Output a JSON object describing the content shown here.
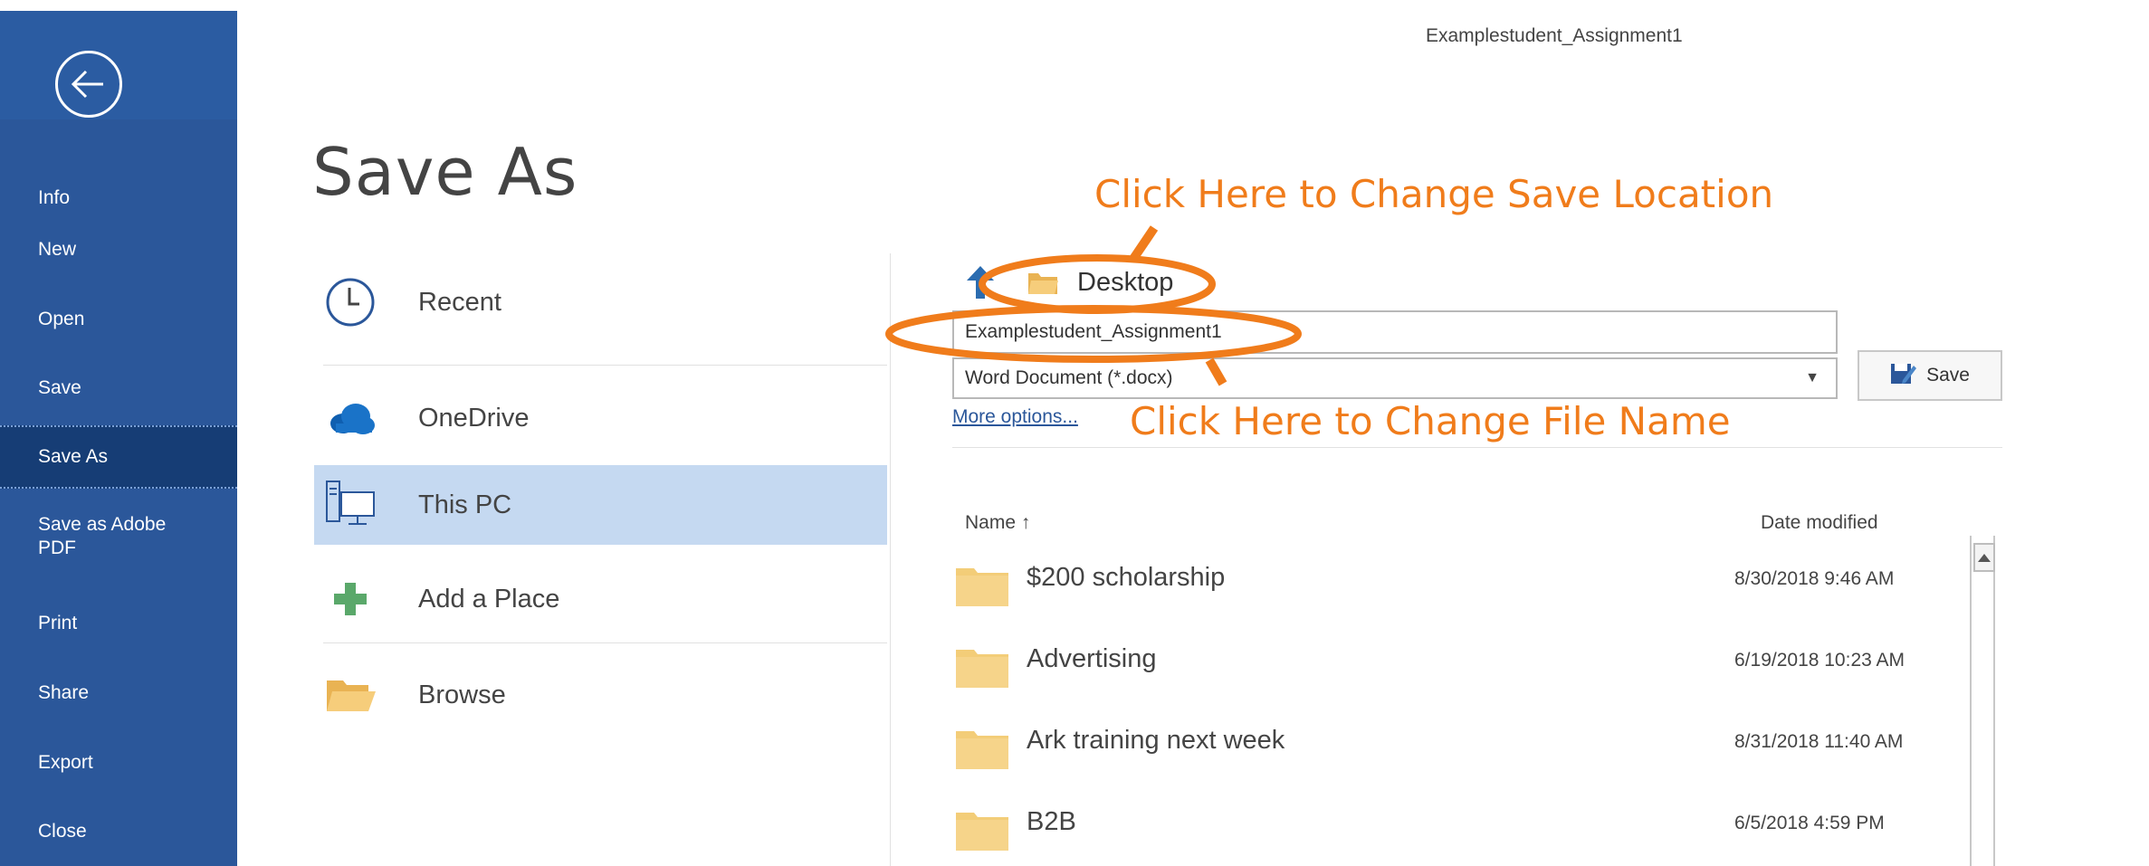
{
  "window": {
    "document_title": "Examplestudent_Assignment1"
  },
  "sidebar": {
    "items": [
      {
        "label": "Info"
      },
      {
        "label": "New"
      },
      {
        "label": "Open"
      },
      {
        "label": "Save"
      },
      {
        "label": "Save As"
      },
      {
        "label": "Save as Adobe PDF"
      },
      {
        "label": "Print"
      },
      {
        "label": "Share"
      },
      {
        "label": "Export"
      },
      {
        "label": "Close"
      }
    ],
    "active": "Save As"
  },
  "page": {
    "title": "Save As"
  },
  "places": [
    {
      "label": "Recent",
      "icon": "clock-icon"
    },
    {
      "label": "OneDrive",
      "icon": "cloud-icon"
    },
    {
      "label": "This PC",
      "icon": "computer-icon",
      "selected": true
    },
    {
      "label": "Add a Place",
      "icon": "plus-icon"
    },
    {
      "label": "Browse",
      "icon": "folder-open-icon"
    }
  ],
  "save_panel": {
    "location": "Desktop",
    "filename": "Examplestudent_Assignment1",
    "filetype": "Word Document (*.docx)",
    "save_label": "Save",
    "more_options": "More options..."
  },
  "file_list": {
    "columns": {
      "name": "Name ↑",
      "date": "Date modified"
    },
    "rows": [
      {
        "name": "$200 scholarship",
        "date": "8/30/2018 9:46 AM"
      },
      {
        "name": "Advertising",
        "date": "6/19/2018 10:23 AM"
      },
      {
        "name": "Ark training next week",
        "date": "8/31/2018 11:40 AM"
      },
      {
        "name": "B2B",
        "date": "6/5/2018 4:59 PM"
      }
    ]
  },
  "annotations": {
    "location_hint": "Click Here to Change Save Location",
    "filename_hint": "Click Here to Change File Name"
  },
  "colors": {
    "sidebar": "#2b579a",
    "sidebar_active": "#163d75",
    "selected_place": "#c5d9f1",
    "annotation": "#f07c1b",
    "folder": "#f3cd78"
  }
}
